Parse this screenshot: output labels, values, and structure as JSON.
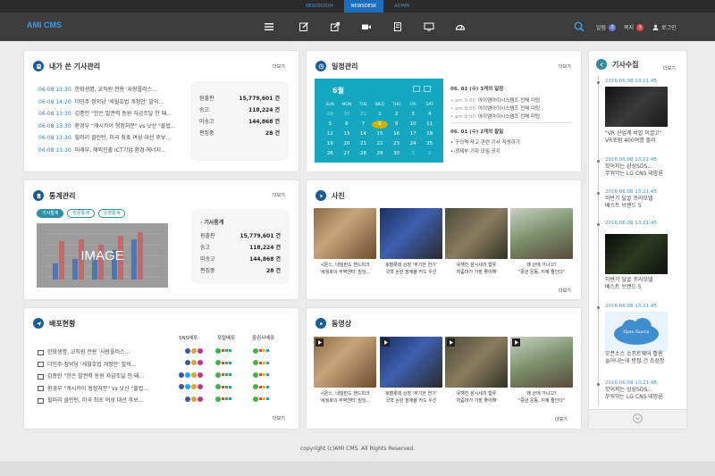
{
  "topnav": [
    "NEWSROOM",
    "NEWSDESK",
    "ADMIN"
  ],
  "header": {
    "logo": "AMI CMS",
    "alarm_label": "알림",
    "alarm_count": "3",
    "notice_label": "쪽지",
    "notice_count": "3",
    "login_label": "로그인"
  },
  "colors": {
    "accent": "#1b6fbd",
    "header_bg": "#3c3c3c",
    "calendar": "#14a7bf",
    "badge_blue": "#5b7fd1",
    "badge_red": "#e04848"
  },
  "more_label": "더보기",
  "my_articles": {
    "title": "내가 쓴 기사관리",
    "items": [
      {
        "date": "06-08 13:30",
        "text": "한화생명, 교직원 전용 '사랑플러스..."
      },
      {
        "date": "06-08 14:20",
        "text": "더민주·정의당 '세월호법 개정안' 발의..."
      },
      {
        "date": "06-08 13:30",
        "text": "김종인 \"한은 발권력 동원 자금조달 안 돼..."
      },
      {
        "date": "06-08 13:30",
        "text": "환경부 \"캐시카이 형정처분\" vs 낫산 \"불법..."
      },
      {
        "date": "06-08 13:30",
        "text": "힐러리 클린턴, 미국 최초 여성 대선 후보..."
      },
      {
        "date": "06-08 13:30",
        "text": "미래부, 해외진출 ICT기업 환경·에너지..."
      }
    ],
    "stats": [
      {
        "label": "원출판",
        "value": "15,779,601 건"
      },
      {
        "label": "송고",
        "value": "118,224 건"
      },
      {
        "label": "미송고",
        "value": "144,868 건"
      },
      {
        "label": "편집중",
        "value": "28 건"
      }
    ]
  },
  "schedule": {
    "title": "일정관리",
    "month": "6월",
    "weekdays": [
      "SUN",
      "MON",
      "TUE",
      "WED",
      "THU",
      "FRI",
      "SAT"
    ],
    "days": [
      "29",
      "30",
      "31",
      "1",
      "2",
      "3",
      "4",
      "5",
      "6",
      "7",
      "8",
      "9",
      "10",
      "11",
      "12",
      "13",
      "14",
      "15",
      "16",
      "17",
      "18",
      "19",
      "20",
      "21",
      "22",
      "23",
      "24",
      "25",
      "26",
      "27",
      "28",
      "29",
      "30",
      "1",
      "2"
    ],
    "day1_heading": "06. 01 (수) 3개의 일정",
    "day1_items": [
      {
        "time": "am 9:00",
        "text": "아이엠아이시스템즈 전체 미팅"
      },
      {
        "time": "am 9:00",
        "text": "아이엠아이시스템즈 전체 미팅"
      },
      {
        "time": "am 9:00",
        "text": "아이엠아이시스템즈 전체 미팅"
      }
    ],
    "day2_heading": "06. 01 (수) 2개의 할일",
    "day2_items": [
      "구의역 사고 관련 기사 작성하기",
      "경제부 기자 모임 공지"
    ]
  },
  "statistics": {
    "title": "통계관리",
    "tabs": [
      "기사통계",
      "방문통계",
      "운영통계"
    ],
    "image_label": "IMAGE",
    "stat_heading": "· 기사통계",
    "stats": [
      {
        "label": "원출판",
        "value": "15,779,601 건"
      },
      {
        "label": "송고",
        "value": "118,224 건"
      },
      {
        "label": "미송고",
        "value": "144,868 건"
      },
      {
        "label": "편집중",
        "value": "28 건"
      }
    ]
  },
  "photos": {
    "title": "사진",
    "items": [
      {
        "caption1": "시온느, 네덜란드 핸드피크",
        "caption2": "'세월호의 무역센터' 빌딩..."
      },
      {
        "caption1": "호텔롯데 상장 '무기한 연기'",
        "caption2": "국혁 논란 장재율 카드 우선"
      },
      {
        "caption1": "유해진 삼시세끼 합류",
        "caption2": "'차줌마가 가장 좋아해'"
      },
      {
        "caption1": "왜 산에 가냐고?",
        "caption2": "\"중년 운동, 지혜 줄인다\""
      }
    ]
  },
  "distribution": {
    "title": "배포현황",
    "col_sns": "SNS배포",
    "col_portal": "포털배포",
    "col_partner": "중권사배포",
    "items": [
      "한화생명, 교직원 전용 '사랑플러스...",
      "더민주·정의당 '세월호법 개정안' 발의...",
      "김종인 \"한은 발권력 동원 자금조달 안 돼...",
      "환경부 \"캐시카이 형정처분\" vs 낫산 \"불법...",
      "힐러리 클린턴, 미국 최초 여성 대선 후보..."
    ]
  },
  "video": {
    "title": "동영상",
    "items": [
      {
        "caption1": "시온느, 네덜란드 핸드피크",
        "caption2": "'세월호의 무역센터' 빌딩..."
      },
      {
        "caption1": "호텔롯데 상장 '무기한 연기'",
        "caption2": "국혁 논란 장재율 카드 우선"
      },
      {
        "caption1": "유해진 삼시세끼 합류",
        "caption2": "'차줌마가 가장 좋아해'"
      },
      {
        "caption1": "왜 산에 가냐고?",
        "caption2": "\"중년 운동, 지혜 줄인다\""
      }
    ]
  },
  "news": {
    "title": "기사수집",
    "items": [
      {
        "time": "2016.06.08 13:21:45",
        "line1": "\"VR 산업계 비밥 이끌고\"",
        "line2": "VR포럼 400여명 몰려"
      },
      {
        "time": "2016.06.08 13:21:45",
        "line1": "핫어지는 삼성SDS...",
        "line2": "무워악는 LG CNS 대망론"
      },
      {
        "time": "2016.06.08 13:21:45",
        "line1": "하반기 달굴 프리모델",
        "line2": "베스트 브랜드 5"
      },
      {
        "time": "2016.06.08 13:21:45",
        "line1": "하반기 달굴 프리모델",
        "line2": "베스트 브랜드 5"
      },
      {
        "time": "2016.06.08 13:21:45",
        "line1": "오픈소스 소프트웨어 활용",
        "line2": "늘어나는데 방정 건 조성정"
      },
      {
        "time": "2016.06.08 13:21:45",
        "line1": "핫어지는 삼성SDS...",
        "line2": "무워악는 LG CNS 대망론"
      }
    ],
    "cloud_label": "Open Source"
  },
  "footer": "copyright (c)AMI CMS. All Rights Reserved."
}
